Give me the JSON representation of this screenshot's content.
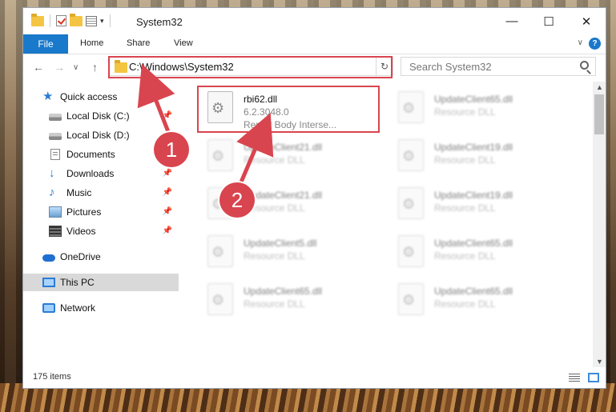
{
  "window": {
    "title": "System32",
    "controls": {
      "minimize": "—",
      "maximize": "☐",
      "close": "✕"
    }
  },
  "qat": {
    "dropdown": "▾"
  },
  "ribbon": {
    "tabs": [
      "File",
      "Home",
      "Share",
      "View"
    ],
    "collapse": "∨",
    "help": "?"
  },
  "nav": {
    "back": "←",
    "forward": "→",
    "recent": "∨",
    "up": "↑",
    "address": "C:\\Windows\\System32",
    "address_dropdown": "∨",
    "refresh": "↻",
    "search_placeholder": "Search System32"
  },
  "sidebar": {
    "items": [
      {
        "label": "Quick access",
        "icon": "star-icon",
        "pinned": false
      },
      {
        "label": "Local Disk (C:)",
        "icon": "drive-icon",
        "pinned": true
      },
      {
        "label": "Local Disk (D:)",
        "icon": "drive-icon",
        "pinned": true
      },
      {
        "label": "Documents",
        "icon": "documents-icon",
        "pinned": true
      },
      {
        "label": "Downloads",
        "icon": "downloads-icon",
        "pinned": true
      },
      {
        "label": "Music",
        "icon": "music-icon",
        "pinned": true
      },
      {
        "label": "Pictures",
        "icon": "pictures-icon",
        "pinned": true
      },
      {
        "label": "Videos",
        "icon": "videos-icon",
        "pinned": true
      },
      {
        "label": "OneDrive",
        "icon": "onedrive-icon",
        "pinned": false
      },
      {
        "label": "This PC",
        "icon": "this-pc-icon",
        "pinned": false,
        "selected": true
      },
      {
        "label": "Network",
        "icon": "network-icon",
        "pinned": false
      }
    ],
    "pin_glyph": "📌"
  },
  "files": [
    {
      "name": "rbi62.dll",
      "line2": "6.2.3048.0",
      "line3": "Repair Body Interse...",
      "highlighted": true
    },
    {
      "name": "UpdateClient65.dll",
      "line2": "Resource DLL"
    },
    {
      "name": "UpdateClient21.dll",
      "line2": "Resource DLL"
    },
    {
      "name": "UpdateClient19.dll",
      "line2": "Resource DLL"
    },
    {
      "name": "UpdateClient21.dll",
      "line2": "Resource DLL"
    },
    {
      "name": "UpdateClient19.dll",
      "line2": "Resource DLL"
    },
    {
      "name": "UpdateClient5.dll",
      "line2": "Resource DLL"
    },
    {
      "name": "UpdateClient65.dll",
      "line2": "Resource DLL"
    },
    {
      "name": "UpdateClient65.dll",
      "line2": "Resource DLL"
    },
    {
      "name": "UpdateClient65.dll",
      "line2": "Resource DLL"
    }
  ],
  "status": {
    "items_count": "175 items"
  },
  "annotations": {
    "callout_1": "1",
    "callout_2": "2",
    "accent_color": "#d9454f"
  },
  "colors": {
    "file_tab": "#1979ca",
    "selection": "#d9d9d9",
    "highlight_box": "#d9454f"
  }
}
